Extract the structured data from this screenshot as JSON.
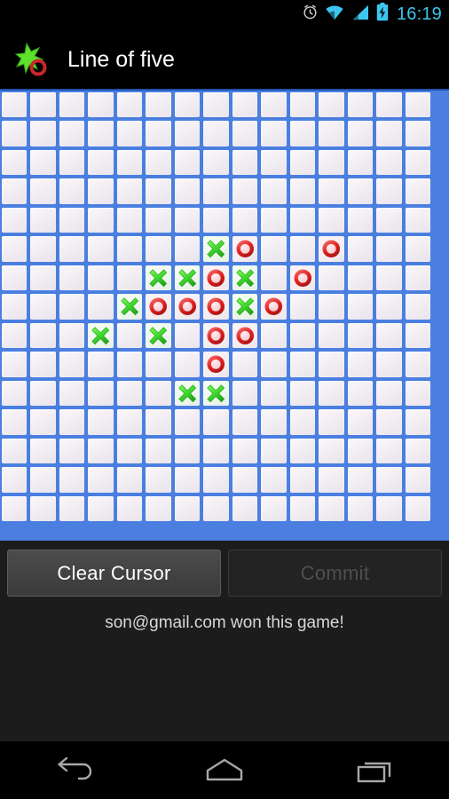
{
  "statusbar": {
    "time": "16:19",
    "icons": [
      "alarm-icon",
      "wifi-icon",
      "cellular-signal-icon",
      "battery-charging-icon"
    ]
  },
  "actionbar": {
    "title": "Line of five",
    "logo_icon": "line-of-five-logo"
  },
  "board": {
    "columns": 15,
    "rows": 15,
    "cell_size": 32.5,
    "grid_line_color": "#4a7fe0",
    "cell_color": "#f2eef3",
    "x_color": "#3ee03e",
    "o_color": "#e02828",
    "pieces": [
      {
        "col": 7,
        "row": 5,
        "type": "X"
      },
      {
        "col": 8,
        "row": 5,
        "type": "O"
      },
      {
        "col": 11,
        "row": 5,
        "type": "O"
      },
      {
        "col": 5,
        "row": 6,
        "type": "X"
      },
      {
        "col": 6,
        "row": 6,
        "type": "X"
      },
      {
        "col": 7,
        "row": 6,
        "type": "O"
      },
      {
        "col": 8,
        "row": 6,
        "type": "X"
      },
      {
        "col": 10,
        "row": 6,
        "type": "O"
      },
      {
        "col": 4,
        "row": 7,
        "type": "X"
      },
      {
        "col": 5,
        "row": 7,
        "type": "O"
      },
      {
        "col": 6,
        "row": 7,
        "type": "O"
      },
      {
        "col": 7,
        "row": 7,
        "type": "O"
      },
      {
        "col": 8,
        "row": 7,
        "type": "X"
      },
      {
        "col": 9,
        "row": 7,
        "type": "O"
      },
      {
        "col": 3,
        "row": 8,
        "type": "X"
      },
      {
        "col": 5,
        "row": 8,
        "type": "X"
      },
      {
        "col": 7,
        "row": 8,
        "type": "O"
      },
      {
        "col": 8,
        "row": 8,
        "type": "O"
      },
      {
        "col": 7,
        "row": 9,
        "type": "O"
      },
      {
        "col": 6,
        "row": 10,
        "type": "X"
      },
      {
        "col": 7,
        "row": 10,
        "type": "X"
      }
    ]
  },
  "controls": {
    "clear_cursor_label": "Clear Cursor",
    "commit_label": "Commit",
    "commit_enabled": false
  },
  "status": {
    "message": "son@gmail.com won this game!"
  },
  "navbar": {
    "back_label": "back-icon",
    "home_label": "home-icon",
    "recents_label": "recents-icon"
  }
}
